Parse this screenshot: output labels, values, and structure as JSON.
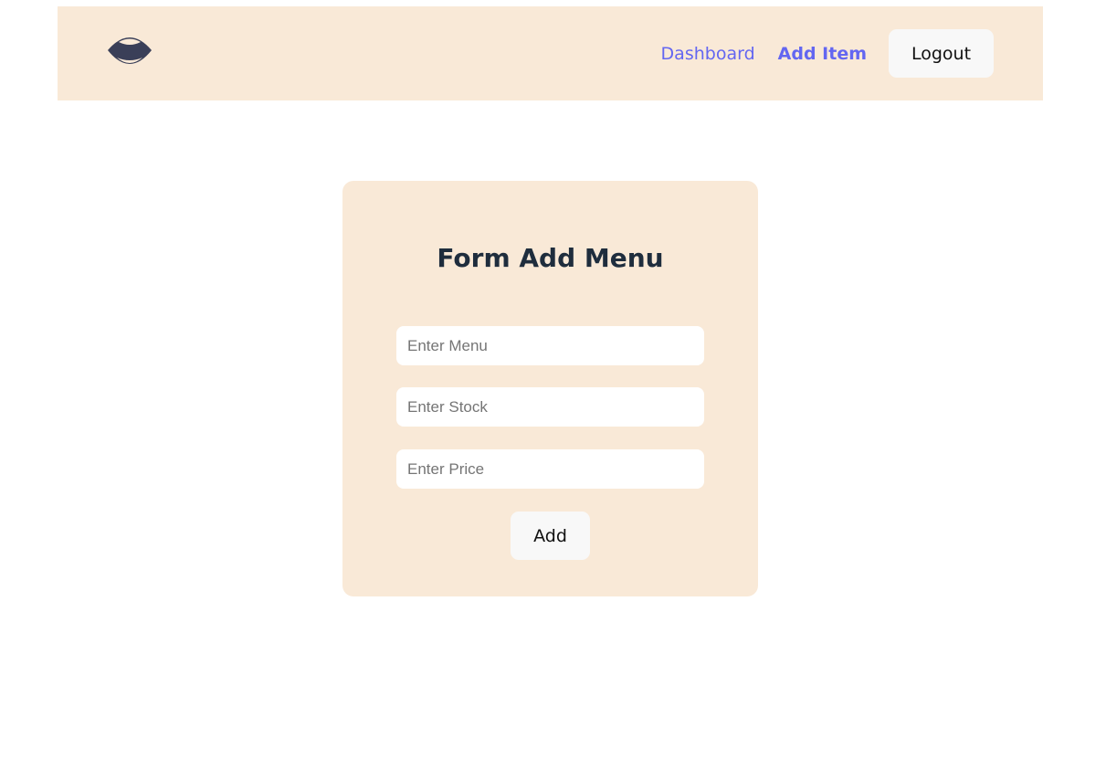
{
  "header": {
    "logo_icon": "lips-logo-icon",
    "nav": {
      "dashboard_label": "Dashboard",
      "add_item_label": "Add Item"
    },
    "logout_label": "Logout"
  },
  "form": {
    "title": "Form Add Menu",
    "menu_placeholder": "Enter Menu",
    "stock_placeholder": "Enter Stock",
    "price_placeholder": "Enter Price",
    "submit_label": "Add"
  },
  "colors": {
    "panel_background": "#f9e9d7",
    "nav_link": "#6366f1",
    "title_text": "#1f2d3d",
    "logo": "#3a3f58",
    "button_background": "#f8f8f8"
  }
}
